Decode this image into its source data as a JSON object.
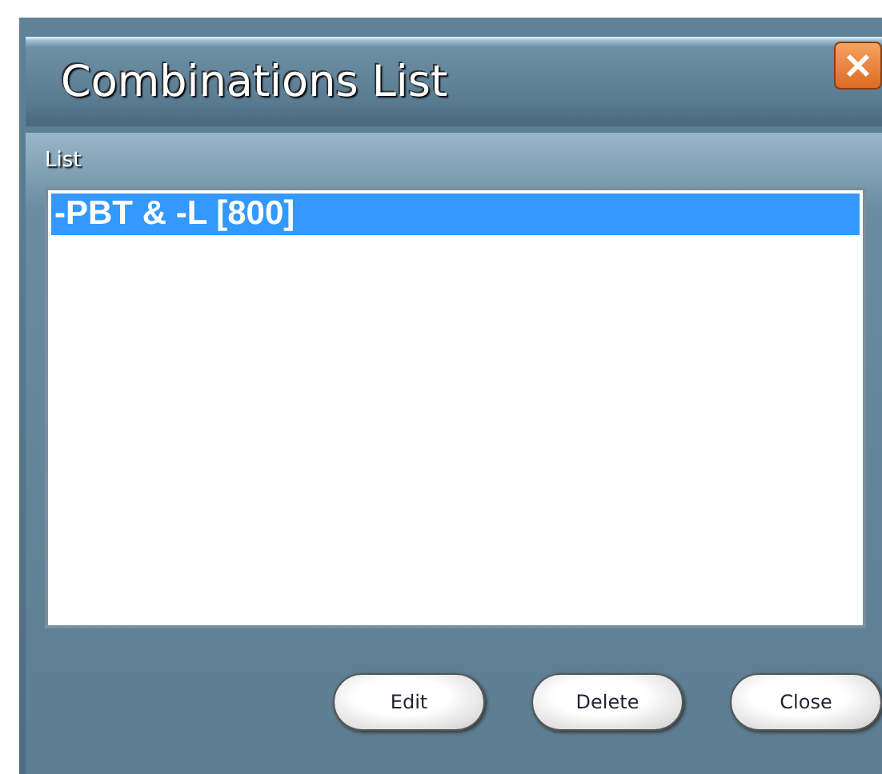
{
  "window": {
    "title": "Combinations List"
  },
  "list": {
    "label": "List",
    "items": [
      {
        "text": "-PBT & -L [800]",
        "selected": true
      }
    ]
  },
  "buttons": [
    "Edit",
    "Delete",
    "Close"
  ]
}
